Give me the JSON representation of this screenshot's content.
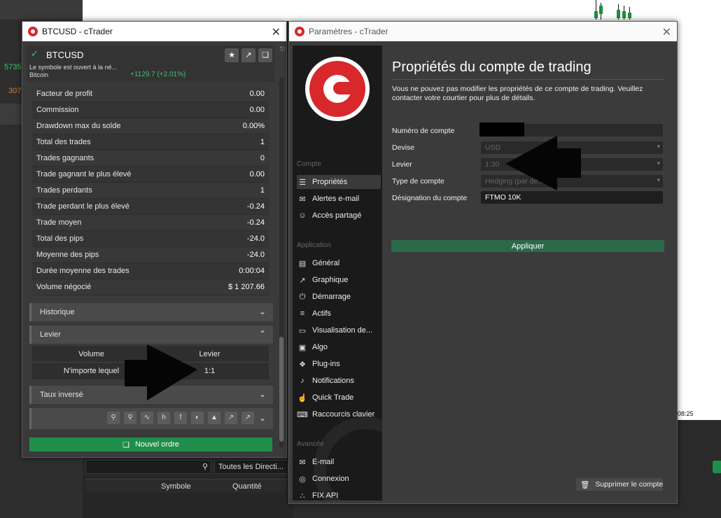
{
  "background": {
    "left_values": [
      "5735",
      "307"
    ],
    "time_label": "08:25",
    "search_placeholder": "",
    "direction_filter": "Toutes les Directi...",
    "columns": [
      "Symbole",
      "Quantité"
    ]
  },
  "btc_window": {
    "title": "BTCUSD - cTrader",
    "symbol": "BTCUSD",
    "status_text": "Le symbole est ouvert à la né...",
    "asset_name": "Bitcoin",
    "change": "+1129.7 (+2.01%)",
    "stats": [
      {
        "label": "Facteur de profit",
        "value": "0.00"
      },
      {
        "label": "Commission",
        "value": "0.00"
      },
      {
        "label": "Drawdown max du solde",
        "value": "0.00%"
      },
      {
        "label": "Total des trades",
        "value": "1"
      },
      {
        "label": "Trades gagnants",
        "value": "0"
      },
      {
        "label": "Trade gagnant le plus élevé",
        "value": "0.00"
      },
      {
        "label": "Trades perdants",
        "value": "1"
      },
      {
        "label": "Trade perdant le plus élevé",
        "value": "-0.24"
      },
      {
        "label": "Trade moyen",
        "value": "-0.24"
      },
      {
        "label": "Total des pips",
        "value": "-24.0"
      },
      {
        "label": "Moyenne des pips",
        "value": "-24.0"
      },
      {
        "label": "Durée moyenne des trades",
        "value": "0:00:04"
      },
      {
        "label": "Volume négocié",
        "value": "$ 1 207.66"
      }
    ],
    "sections": {
      "historique": "Historique",
      "levier": "Levier",
      "taux_inverse": "Taux inversé"
    },
    "levier_table": {
      "headers": [
        "Volume",
        "Levier"
      ],
      "row": [
        "N'importe lequel",
        "1:1"
      ]
    },
    "new_order": "Nouvel ordre"
  },
  "settings_window": {
    "title": "Paramètres - cTrader",
    "groups": {
      "compte": "Compte",
      "application": "Application",
      "avancee": "Avancée"
    },
    "compte_items": [
      {
        "label": "Propriétés",
        "icon": "sliders-icon"
      },
      {
        "label": "Alertes e-mail",
        "icon": "envelope-icon"
      },
      {
        "label": "Accès partagé",
        "icon": "add-user-icon"
      }
    ],
    "application_items": [
      {
        "label": "Général",
        "icon": "layout-icon"
      },
      {
        "label": "Graphique",
        "icon": "chart-icon"
      },
      {
        "label": "Démarrage",
        "icon": "power-icon"
      },
      {
        "label": "Actifs",
        "icon": "list-icon"
      },
      {
        "label": "Visualisation de...",
        "icon": "view-icon"
      },
      {
        "label": "Algo",
        "icon": "robot-icon"
      },
      {
        "label": "Plug-ins",
        "icon": "puzzle-icon"
      },
      {
        "label": "Notifications",
        "icon": "bell-icon"
      },
      {
        "label": "Quick Trade",
        "icon": "hand-pointer-icon"
      },
      {
        "label": "Raccourcis clavier",
        "icon": "keyboard-icon"
      }
    ],
    "avancee_items": [
      {
        "label": "E-mail",
        "icon": "envelope-icon"
      },
      {
        "label": "Connexion",
        "icon": "globe-icon"
      },
      {
        "label": "FIX API",
        "icon": "network-icon"
      }
    ],
    "panel": {
      "title": "Propriétés du compte de trading",
      "description": "Vous ne pouvez pas modifier les propriétés de ce compte de trading. Veuillez contacter votre courtier pour plus de détails.",
      "fields": {
        "account_number": {
          "label": "Numéro de compte",
          "value": ""
        },
        "currency": {
          "label": "Devise",
          "value": "USD"
        },
        "leverage": {
          "label": "Levier",
          "value": "1:30"
        },
        "account_type": {
          "label": "Type de compte",
          "value": "Hedging (par dé..."
        },
        "designation": {
          "label": "Désignation du compte",
          "value": "FTMO 10K"
        }
      },
      "apply": "Appliquer",
      "delete": "Supprimer le compte"
    }
  },
  "colors": {
    "accent_green": "#1e8e4a",
    "brand_red": "#d8282c",
    "positive": "#3ec46d"
  }
}
